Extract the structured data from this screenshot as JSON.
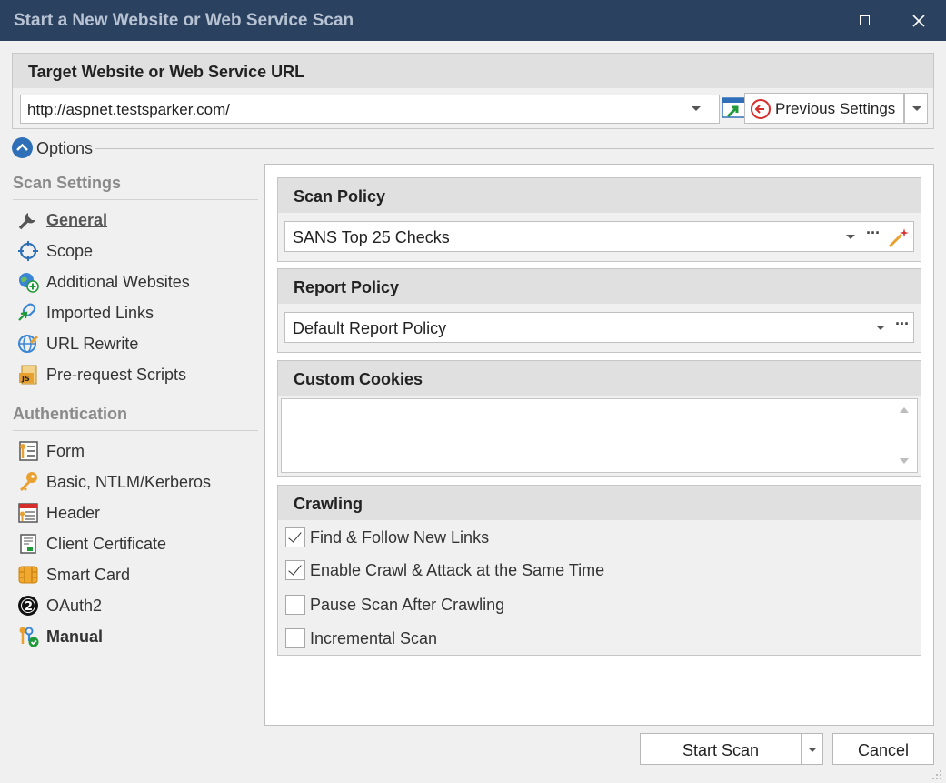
{
  "window": {
    "title": "Start a New Website or Web Service Scan",
    "maximize_icon": "maximize-icon",
    "close_icon": "close-icon"
  },
  "target": {
    "heading": "Target Website or Web Service URL",
    "url_value": "http://aspnet.testsparker.com/",
    "previous_settings_label": "Previous Settings"
  },
  "options": {
    "label": "Options"
  },
  "sidebar": {
    "scan_settings_heading": "Scan Settings",
    "scan_settings_items": [
      {
        "label": "General",
        "icon": "wrench-icon",
        "active": true
      },
      {
        "label": "Scope",
        "icon": "crosshair-icon"
      },
      {
        "label": "Additional Websites",
        "icon": "globe-add-icon"
      },
      {
        "label": "Imported Links",
        "icon": "link-import-icon"
      },
      {
        "label": "URL Rewrite",
        "icon": "globe-pencil-icon"
      },
      {
        "label": "Pre-request Scripts",
        "icon": "js-script-icon"
      }
    ],
    "authentication_heading": "Authentication",
    "authentication_items": [
      {
        "label": "Form",
        "icon": "form-key-icon"
      },
      {
        "label": "Basic, NTLM/Kerberos",
        "icon": "key-icon"
      },
      {
        "label": "Header",
        "icon": "header-window-icon"
      },
      {
        "label": "Client Certificate",
        "icon": "certificate-icon"
      },
      {
        "label": "Smart Card",
        "icon": "smart-card-icon"
      },
      {
        "label": "OAuth2",
        "icon": "oauth2-icon"
      },
      {
        "label": "Manual",
        "icon": "manual-keys-check-icon",
        "bold": true
      }
    ]
  },
  "scan_policy": {
    "heading": "Scan Policy",
    "value": "SANS Top 25 Checks"
  },
  "report_policy": {
    "heading": "Report Policy",
    "value": "Default Report Policy"
  },
  "custom_cookies": {
    "heading": "Custom Cookies",
    "value": ""
  },
  "crawling": {
    "heading": "Crawling",
    "options": [
      {
        "label": "Find & Follow New Links",
        "checked": true
      },
      {
        "label": "Enable Crawl & Attack at the Same Time",
        "checked": true
      },
      {
        "label": "Pause Scan After Crawling",
        "checked": false
      },
      {
        "label": "Incremental Scan",
        "checked": false
      }
    ]
  },
  "footer": {
    "start_scan_label": "Start Scan",
    "cancel_label": "Cancel"
  },
  "colors": {
    "titlebar": "#2b4160",
    "accent_blue": "#2e6fb7",
    "previous_red": "#d62d2d"
  }
}
